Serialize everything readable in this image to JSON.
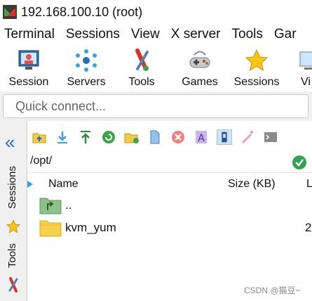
{
  "window": {
    "title": "192.168.100.10 (root)"
  },
  "menu": [
    "Terminal",
    "Sessions",
    "View",
    "X server",
    "Tools",
    "Gar"
  ],
  "toolbar": [
    {
      "label": "Session",
      "icon": "session-icon"
    },
    {
      "label": "Servers",
      "icon": "servers-icon"
    },
    {
      "label": "Tools",
      "icon": "tools-icon"
    },
    {
      "label": "Games",
      "icon": "games-icon"
    },
    {
      "label": "Sessions",
      "icon": "star-icon"
    },
    {
      "label": "Vi",
      "icon": "view-icon"
    }
  ],
  "quick_connect": {
    "placeholder": "Quick connect..."
  },
  "side_tabs": {
    "sessions": "Sessions",
    "tools": "Tools"
  },
  "sftp": {
    "path": "/opt/",
    "columns": {
      "name": "Name",
      "size": "Size (KB)",
      "last": "L"
    },
    "rows": [
      {
        "name": "..",
        "size": "",
        "icon": "parent-folder-icon"
      },
      {
        "name": "kvm_yum",
        "size": "2",
        "icon": "folder-icon"
      }
    ]
  },
  "watermark": "CSDN @猫豆~",
  "colors": {
    "accent": "#1a6fc9",
    "ok": "#2ea44f",
    "folder": "#f7d04a"
  }
}
